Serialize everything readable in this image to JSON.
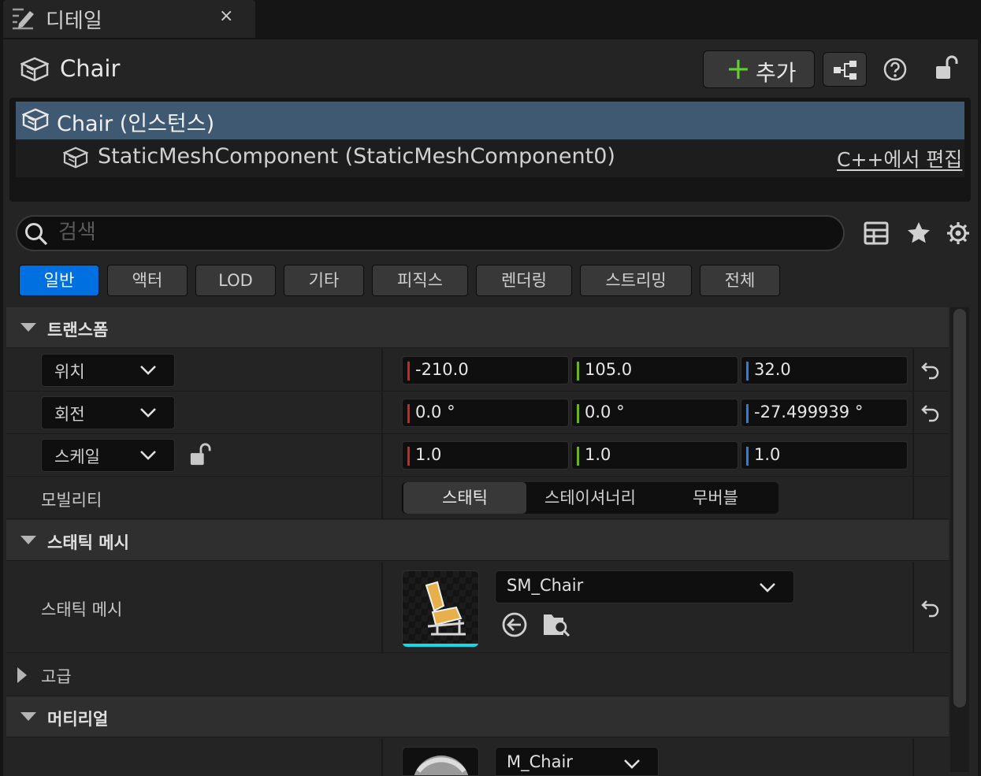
{
  "tab": {
    "title": "디테일",
    "close": "×"
  },
  "header": {
    "title": "Chair",
    "add_label": "추가",
    "add_plus": "+"
  },
  "tree": {
    "root_label": "Chair (인스턴스)",
    "child_label": "StaticMeshComponent (StaticMeshComponent0)",
    "edit_link": "C++에서 편집"
  },
  "search": {
    "placeholder": "검색",
    "value": ""
  },
  "filters": [
    "일반",
    "액터",
    "LOD",
    "기타",
    "피직스",
    "렌더링",
    "스트리밍",
    "전체"
  ],
  "active_filter": "일반",
  "transform": {
    "title": "트랜스폼",
    "location": {
      "label": "위치",
      "x": "-210.0",
      "y": "105.0",
      "z": "32.0"
    },
    "rotation": {
      "label": "회전",
      "x": "0.0 °",
      "y": "0.0 °",
      "z": "-27.499939 °"
    },
    "scale": {
      "label": "스케일",
      "x": "1.0",
      "y": "1.0",
      "z": "1.0"
    },
    "mobility": {
      "label": "모빌리티",
      "options": [
        "스태틱",
        "스테이셔너리",
        "무버블"
      ],
      "selected": "스태틱"
    }
  },
  "static_mesh": {
    "title": "스태틱 메시",
    "row_label": "스태틱 메시",
    "asset": "SM_Chair"
  },
  "advanced": {
    "title": "고급"
  },
  "material": {
    "title": "머티리얼",
    "asset": "M_Chair"
  },
  "colors": {
    "accent": "#0070e0",
    "x_axis": "#c8281e",
    "y_axis": "#6cb324",
    "z_axis": "#2f7bd8",
    "add_plus": "#5fd02e",
    "selected_row": "#405972"
  }
}
